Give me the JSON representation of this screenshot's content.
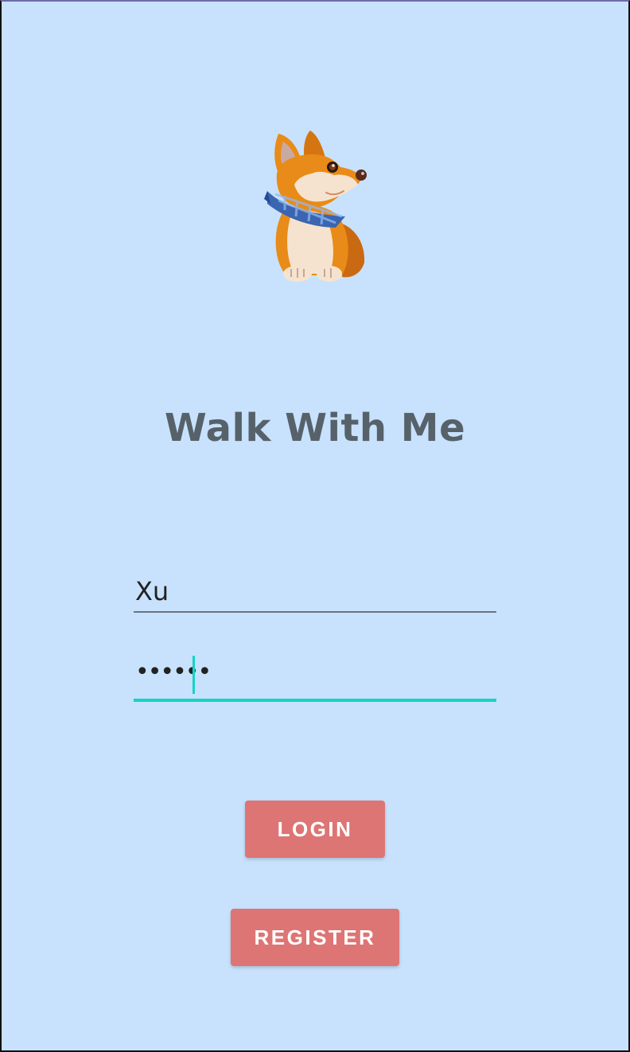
{
  "app": {
    "title": "Walk With Me",
    "logo_icon": "corgi-dog-icon"
  },
  "login_form": {
    "username_value": "Xu",
    "password_value": "••••••",
    "login_label": "LOGIN",
    "register_label": "REGISTER"
  },
  "colors": {
    "background": "#c8e2fd",
    "title": "#56616a",
    "button": "#dd7574",
    "button_text": "#ffffff",
    "focus_accent": "#15d3c5",
    "underline": "#6b7480"
  }
}
